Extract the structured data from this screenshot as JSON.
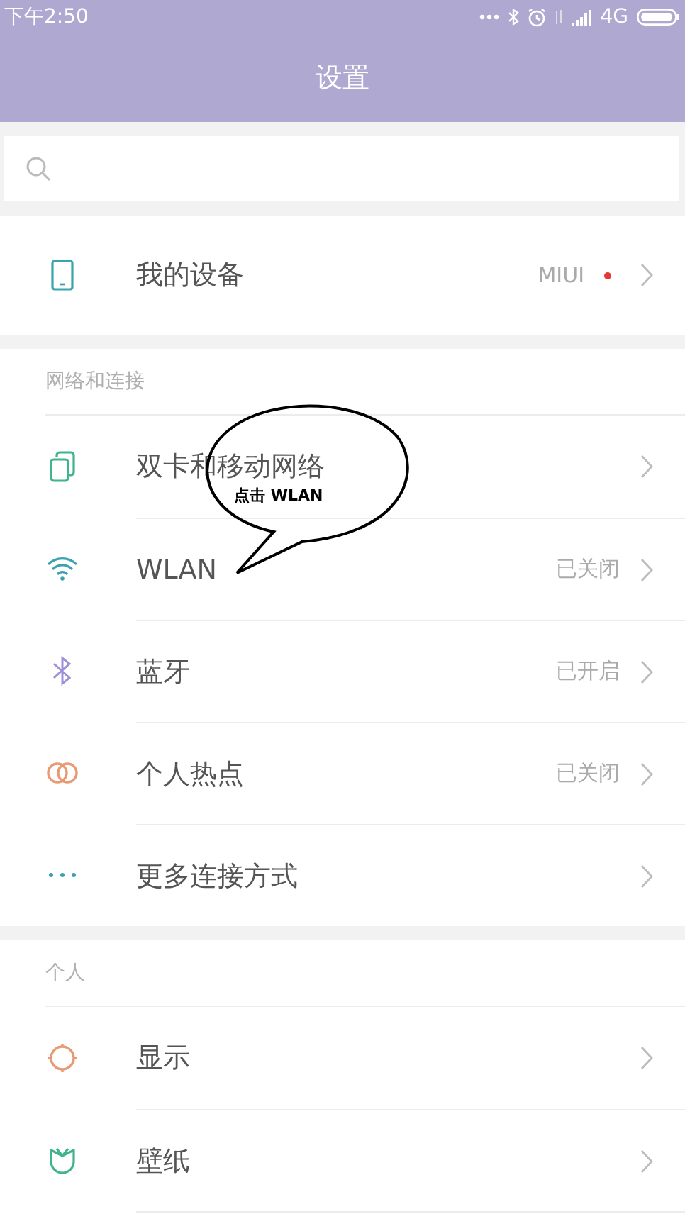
{
  "status_bar": {
    "time": "下午2:50",
    "network": "4G"
  },
  "title": "设置",
  "sections": [
    {
      "rows": [
        {
          "label": "我的设备",
          "value": "MIUI",
          "badge_dot": true
        }
      ]
    },
    {
      "header": "网络和连接",
      "rows": [
        {
          "label": "双卡和移动网络"
        },
        {
          "label": "WLAN",
          "value": "已关闭"
        },
        {
          "label": "蓝牙",
          "value": "已开启"
        },
        {
          "label": "个人热点",
          "value": "已关闭"
        },
        {
          "label": "更多连接方式"
        }
      ]
    },
    {
      "header": "个人",
      "rows": [
        {
          "label": "显示"
        },
        {
          "label": "壁纸"
        }
      ]
    }
  ],
  "callout": {
    "text": "点击 WLAN"
  }
}
